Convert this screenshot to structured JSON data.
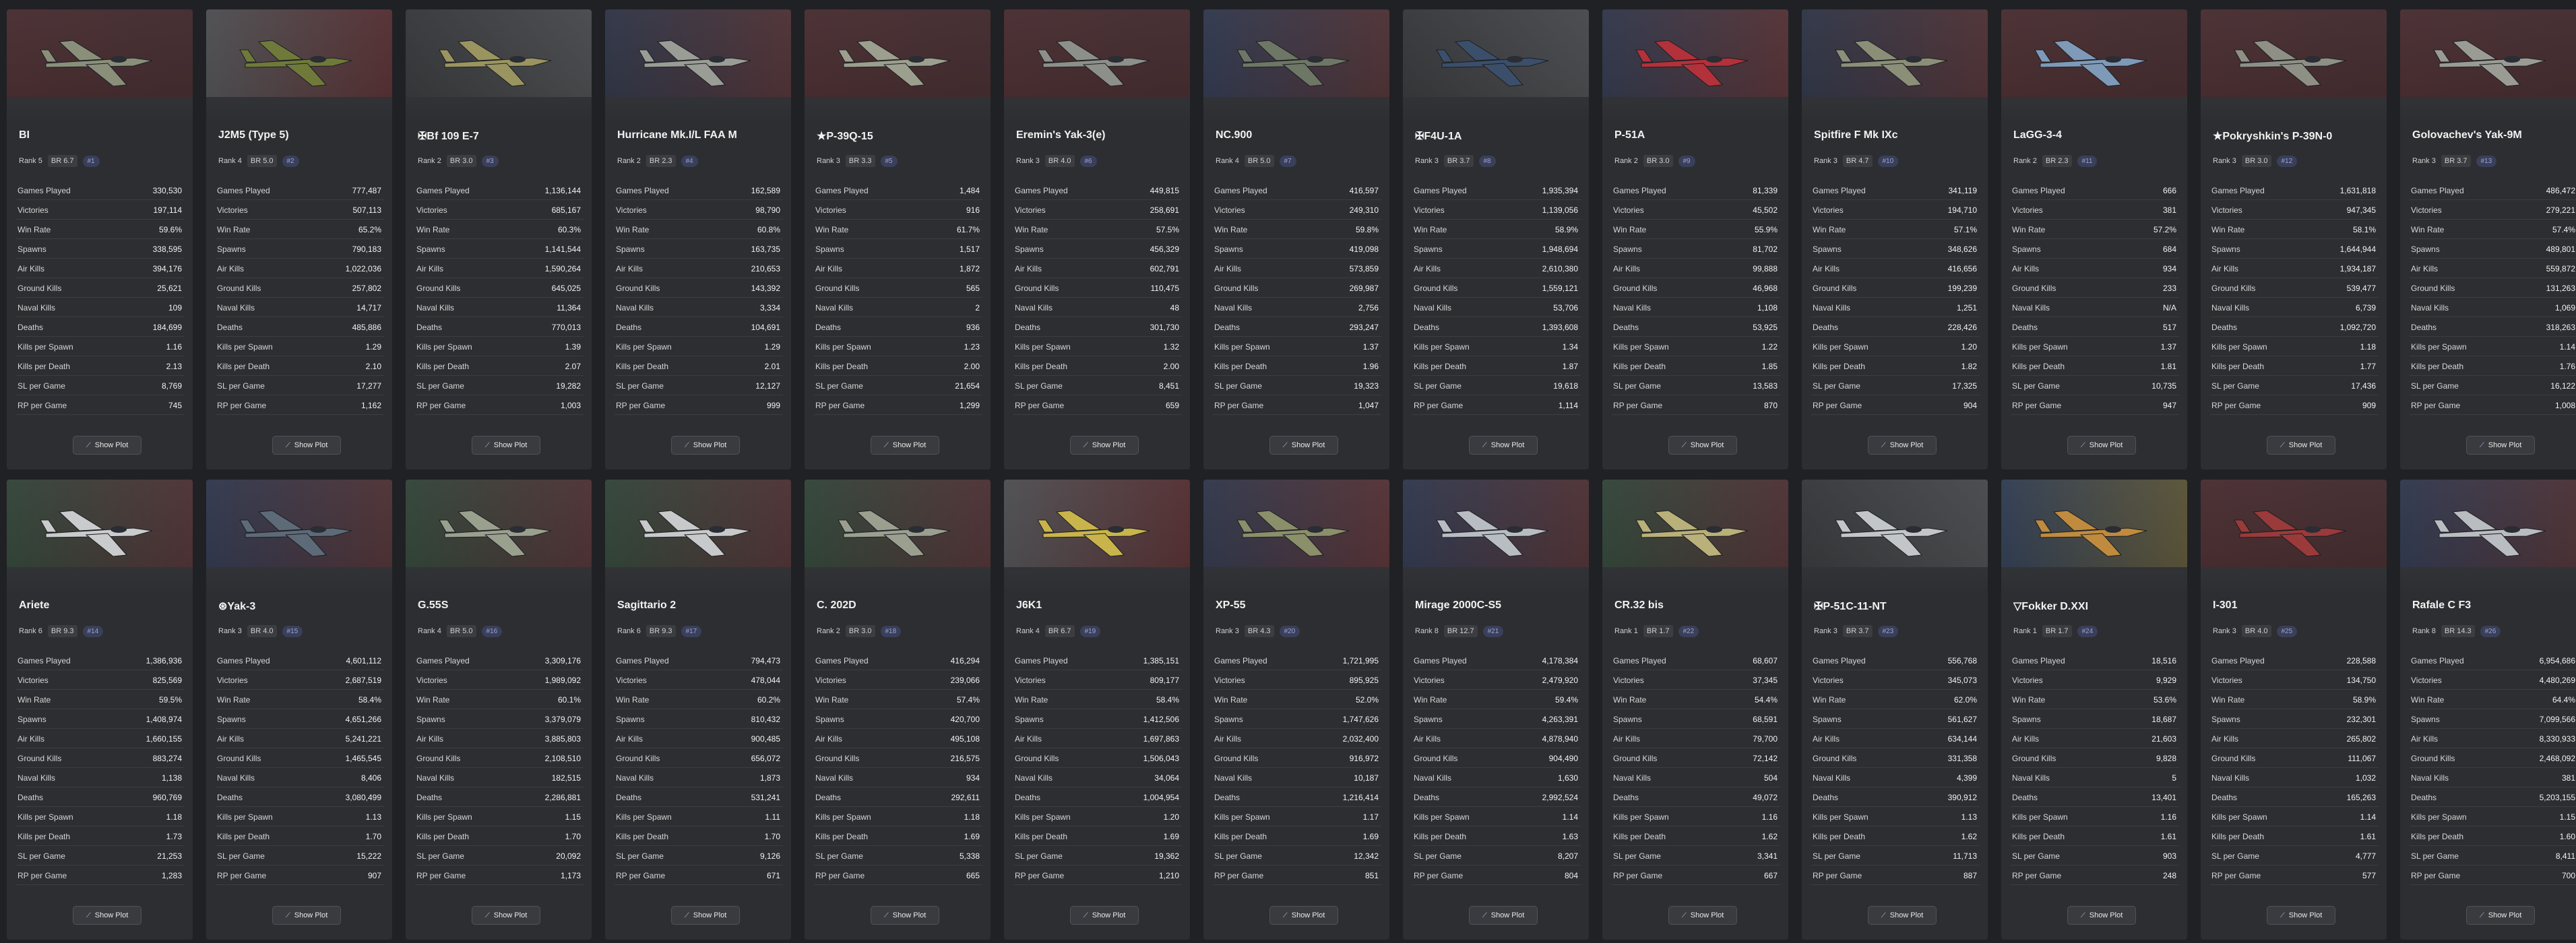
{
  "stat_labels": [
    "Games Played",
    "Victories",
    "Win Rate",
    "Spawns",
    "Air Kills",
    "Ground Kills",
    "Naval Kills",
    "Deaths",
    "Kills per Spawn",
    "Kills per Death",
    "SL per Game",
    "RP per Game"
  ],
  "button_label": "Show Plot",
  "icons": {
    "plot": "chart-line-icon"
  },
  "colors": {
    "background": "#202124",
    "card": "#2d2e31",
    "badge": "#3b3d41",
    "index_badge": "#3a3f5a"
  },
  "vehicles": [
    {
      "name": "BI",
      "rank": "Rank 5",
      "br": "BR 6.7",
      "index": "#1",
      "flag": "USSR",
      "plane_color": "#8a8f7a",
      "stats": [
        "330,530",
        "197,114",
        "59.6%",
        "338,595",
        "394,176",
        "25,621",
        "109",
        "184,699",
        "1.16",
        "2.13",
        "8,769",
        "745"
      ]
    },
    {
      "name": "J2M5 (Type 5)",
      "rank": "Rank 4",
      "br": "BR 5.0",
      "index": "#2",
      "flag": "Japan",
      "plane_color": "#6f7a3a",
      "stats": [
        "777,487",
        "507,113",
        "65.2%",
        "790,183",
        "1,022,036",
        "257,802",
        "14,717",
        "485,886",
        "1.29",
        "2.10",
        "17,277",
        "1,162"
      ]
    },
    {
      "name": "✠Bf 109 E-7",
      "rank": "Rank 2",
      "br": "BR 3.0",
      "index": "#3",
      "flag": "Germany",
      "plane_color": "#9a9460",
      "stats": [
        "1,136,144",
        "685,167",
        "60.3%",
        "1,141,544",
        "1,590,264",
        "645,025",
        "11,364",
        "770,013",
        "1.39",
        "2.07",
        "19,282",
        "1,003"
      ]
    },
    {
      "name": "Hurricane Mk.I/L FAA M",
      "rank": "Rank 2",
      "br": "BR 2.3",
      "index": "#4",
      "flag": "UK",
      "plane_color": "#9a9c96",
      "stats": [
        "162,589",
        "98,790",
        "60.8%",
        "163,735",
        "210,653",
        "143,392",
        "3,334",
        "104,691",
        "1.29",
        "2.01",
        "12,127",
        "999"
      ]
    },
    {
      "name": "★P-39Q-15",
      "rank": "Rank 3",
      "br": "BR 3.3",
      "index": "#5",
      "flag": "USSR",
      "plane_color": "#9c9f8e",
      "stats": [
        "1,484",
        "916",
        "61.7%",
        "1,517",
        "1,872",
        "565",
        "2",
        "936",
        "1.23",
        "2.00",
        "21,654",
        "1,299"
      ]
    },
    {
      "name": "Eremin's Yak-3(e)",
      "rank": "Rank 3",
      "br": "BR 4.0",
      "index": "#6",
      "flag": "USSR",
      "plane_color": "#8d8f8a",
      "stats": [
        "449,815",
        "258,691",
        "57.5%",
        "456,329",
        "602,791",
        "110,475",
        "48",
        "301,730",
        "1.32",
        "2.00",
        "8,451",
        "659"
      ]
    },
    {
      "name": "NC.900",
      "rank": "Rank 4",
      "br": "BR 5.0",
      "index": "#7",
      "flag": "France",
      "plane_color": "#6e7765",
      "stats": [
        "416,597",
        "249,310",
        "59.8%",
        "419,098",
        "573,859",
        "269,987",
        "2,756",
        "293,247",
        "1.37",
        "1.96",
        "19,323",
        "1,047"
      ]
    },
    {
      "name": "✠F4U-1A",
      "rank": "Rank 3",
      "br": "BR 3.7",
      "index": "#8",
      "flag": "Germany",
      "plane_color": "#3b4f6b",
      "stats": [
        "1,935,394",
        "1,139,056",
        "58.9%",
        "1,948,694",
        "2,610,380",
        "1,559,121",
        "53,706",
        "1,393,608",
        "1.34",
        "1.87",
        "19,618",
        "1,114"
      ]
    },
    {
      "name": "P-51A",
      "rank": "Rank 2",
      "br": "BR 3.0",
      "index": "#9",
      "flag": "USA",
      "plane_color": "#b3313a",
      "stats": [
        "81,339",
        "45,502",
        "55.9%",
        "81,702",
        "99,888",
        "46,968",
        "1,108",
        "53,925",
        "1.22",
        "1.85",
        "13,583",
        "870"
      ]
    },
    {
      "name": "Spitfire F Mk IXc",
      "rank": "Rank 3",
      "br": "BR 4.7",
      "index": "#10",
      "flag": "UK",
      "plane_color": "#8b8f78",
      "stats": [
        "341,119",
        "194,710",
        "57.1%",
        "348,626",
        "416,656",
        "199,239",
        "1,251",
        "228,426",
        "1.20",
        "1.82",
        "17,325",
        "904"
      ]
    },
    {
      "name": "LaGG-3-4",
      "rank": "Rank 2",
      "br": "BR 2.3",
      "index": "#11",
      "flag": "USSR",
      "plane_color": "#7f9ab8",
      "stats": [
        "666",
        "381",
        "57.2%",
        "684",
        "934",
        "233",
        "N/A",
        "517",
        "1.37",
        "1.81",
        "10,735",
        "947"
      ]
    },
    {
      "name": "★Pokryshkin's P-39N-0",
      "rank": "Rank 3",
      "br": "BR 3.0",
      "index": "#12",
      "flag": "USSR",
      "plane_color": "#8e9086",
      "stats": [
        "1,631,818",
        "947,345",
        "58.1%",
        "1,644,944",
        "1,934,187",
        "539,477",
        "6,739",
        "1,092,720",
        "1.18",
        "1.77",
        "17,436",
        "909"
      ]
    },
    {
      "name": "Golovachev's Yak-9M",
      "rank": "Rank 3",
      "br": "BR 3.7",
      "index": "#13",
      "flag": "USSR",
      "plane_color": "#9a9c94",
      "stats": [
        "486,472",
        "279,221",
        "57.4%",
        "489,801",
        "559,872",
        "131,263",
        "1,069",
        "318,263",
        "1.14",
        "1.76",
        "16,122",
        "1,008"
      ]
    },
    {
      "name": "Ariete",
      "rank": "Rank 6",
      "br": "BR 9.3",
      "index": "#14",
      "flag": "Italy",
      "plane_color": "#c9cbcc",
      "stats": [
        "1,386,936",
        "825,569",
        "59.5%",
        "1,408,974",
        "1,660,155",
        "883,274",
        "1,138",
        "960,769",
        "1.18",
        "1.73",
        "21,253",
        "1,283"
      ]
    },
    {
      "name": "⊛Yak-3",
      "rank": "Rank 3",
      "br": "BR 4.0",
      "index": "#15",
      "flag": "France",
      "plane_color": "#5d6a78",
      "stats": [
        "4,601,112",
        "2,687,519",
        "58.4%",
        "4,651,266",
        "5,241,221",
        "1,465,545",
        "8,406",
        "3,080,499",
        "1.13",
        "1.70",
        "15,222",
        "907"
      ]
    },
    {
      "name": "G.55S",
      "rank": "Rank 4",
      "br": "BR 5.0",
      "index": "#16",
      "flag": "Italy",
      "plane_color": "#9aa08e",
      "stats": [
        "3,309,176",
        "1,989,092",
        "60.1%",
        "3,379,079",
        "3,885,803",
        "2,108,510",
        "182,515",
        "2,286,881",
        "1.15",
        "1.70",
        "20,092",
        "1,173"
      ]
    },
    {
      "name": "Sagittario 2",
      "rank": "Rank 6",
      "br": "BR 9.3",
      "index": "#17",
      "flag": "Italy",
      "plane_color": "#c7c9cb",
      "stats": [
        "794,473",
        "478,044",
        "60.2%",
        "810,432",
        "900,485",
        "656,072",
        "1,873",
        "531,241",
        "1.11",
        "1.70",
        "9,126",
        "671"
      ]
    },
    {
      "name": "C. 202D",
      "rank": "Rank 2",
      "br": "BR 3.0",
      "index": "#18",
      "flag": "Italy",
      "plane_color": "#9a9f90",
      "stats": [
        "416,294",
        "239,066",
        "57.4%",
        "420,700",
        "495,108",
        "216,575",
        "934",
        "292,611",
        "1.18",
        "1.69",
        "5,338",
        "665"
      ]
    },
    {
      "name": "J6K1",
      "rank": "Rank 4",
      "br": "BR 6.7",
      "index": "#19",
      "flag": "Japan",
      "plane_color": "#c8b44a",
      "stats": [
        "1,385,151",
        "809,177",
        "58.4%",
        "1,412,506",
        "1,697,863",
        "1,506,043",
        "34,064",
        "1,004,954",
        "1.20",
        "1.69",
        "19,362",
        "1,210"
      ]
    },
    {
      "name": "XP-55",
      "rank": "Rank 3",
      "br": "BR 4.3",
      "index": "#20",
      "flag": "USA",
      "plane_color": "#8b8f6a",
      "stats": [
        "1,721,995",
        "895,925",
        "52.0%",
        "1,747,626",
        "2,032,400",
        "916,972",
        "10,187",
        "1,216,414",
        "1.17",
        "1.69",
        "12,342",
        "851"
      ]
    },
    {
      "name": "Mirage 2000C-S5",
      "rank": "Rank 8",
      "br": "BR 12.7",
      "index": "#21",
      "flag": "France",
      "plane_color": "#b8bdc4",
      "stats": [
        "4,178,384",
        "2,479,920",
        "59.4%",
        "4,263,391",
        "4,878,940",
        "904,490",
        "1,630",
        "2,992,524",
        "1.14",
        "1.63",
        "8,207",
        "804"
      ]
    },
    {
      "name": "CR.32 bis",
      "rank": "Rank 1",
      "br": "BR 1.7",
      "index": "#22",
      "flag": "Italy",
      "plane_color": "#b9b07a",
      "stats": [
        "68,607",
        "37,345",
        "54.4%",
        "68,591",
        "79,700",
        "72,142",
        "504",
        "49,072",
        "1.16",
        "1.62",
        "3,341",
        "667"
      ]
    },
    {
      "name": "✠P-51C-11-NT",
      "rank": "Rank 3",
      "br": "BR 3.7",
      "index": "#23",
      "flag": "Germany",
      "plane_color": "#c3c6c9",
      "stats": [
        "556,768",
        "345,073",
        "62.0%",
        "561,627",
        "634,144",
        "331,358",
        "4,399",
        "390,912",
        "1.13",
        "1.62",
        "11,713",
        "887"
      ]
    },
    {
      "name": "▽Fokker D.XXI",
      "rank": "Rank 1",
      "br": "BR 1.7",
      "index": "#24",
      "flag": "Sweden",
      "plane_color": "#c08b3e",
      "stats": [
        "18,516",
        "9,929",
        "53.6%",
        "18,687",
        "21,603",
        "9,828",
        "5",
        "13,401",
        "1.16",
        "1.61",
        "903",
        "248"
      ]
    },
    {
      "name": "I-301",
      "rank": "Rank 3",
      "br": "BR 4.0",
      "index": "#25",
      "flag": "USSR",
      "plane_color": "#9a3a3a",
      "stats": [
        "228,588",
        "134,750",
        "58.9%",
        "232,301",
        "265,802",
        "111,067",
        "1,032",
        "165,263",
        "1.14",
        "1.61",
        "4,777",
        "577"
      ]
    },
    {
      "name": "Rafale C F3",
      "rank": "Rank 8",
      "br": "BR 14.3",
      "index": "#26",
      "flag": "France",
      "plane_color": "#b9bcc0",
      "stats": [
        "6,954,686",
        "4,480,269",
        "64.4%",
        "7,099,566",
        "8,330,933",
        "2,468,092",
        "381",
        "5,203,155",
        "1.15",
        "1.60",
        "8,411",
        "700"
      ]
    }
  ]
}
